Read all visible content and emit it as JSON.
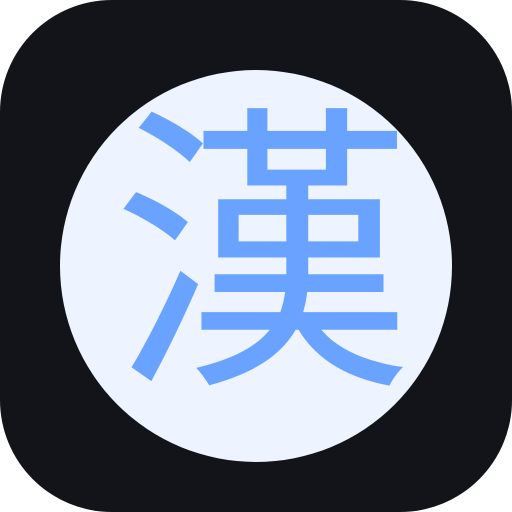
{
  "icon": {
    "glyph": "漢",
    "background_color": "#121419",
    "circle_color": "#eef4ff",
    "glyph_color": "#6aa3ff"
  }
}
